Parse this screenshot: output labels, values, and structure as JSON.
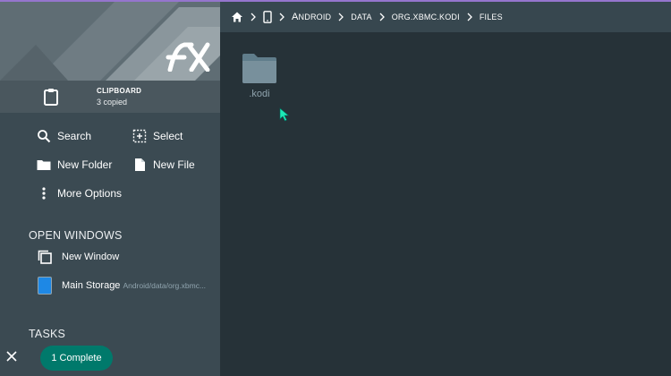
{
  "app": {
    "logo_text": "FX",
    "accent_color": "#00796b"
  },
  "sidebar": {
    "clipboard": {
      "icon": "clipboard-icon",
      "title": "CLIPBOARD",
      "subtitle": "3 copied"
    },
    "actions": [
      {
        "label": "Search",
        "icon": "search-icon"
      },
      {
        "label": "Select",
        "icon": "select-icon"
      },
      {
        "label": "New Folder",
        "icon": "folder-icon"
      },
      {
        "label": "New File",
        "icon": "file-icon"
      },
      {
        "label": "More Options",
        "icon": "more-vert-icon"
      }
    ],
    "open_windows": {
      "title": "OPEN WINDOWS",
      "items": [
        {
          "label": "New Window",
          "subtitle": "",
          "icon": "new-window-icon"
        },
        {
          "label": "Main Storage",
          "subtitle": "Android/data/org.xbmc...",
          "icon": "storage-icon"
        }
      ]
    },
    "tasks": {
      "title": "TASKS",
      "complete_label": "1 Complete",
      "close_icon": "close-icon"
    }
  },
  "breadcrumb": {
    "home_icon": "home-icon",
    "device_icon": "phone-icon",
    "items": [
      {
        "first": "A",
        "rest": "NDROID"
      },
      {
        "first": "",
        "rest": "DATA"
      },
      {
        "first": "",
        "rest": "ORG.XBMC.KODI"
      },
      {
        "first": "",
        "rest": "FILES"
      }
    ]
  },
  "files": [
    {
      "name": ".kodi",
      "type": "folder"
    }
  ]
}
